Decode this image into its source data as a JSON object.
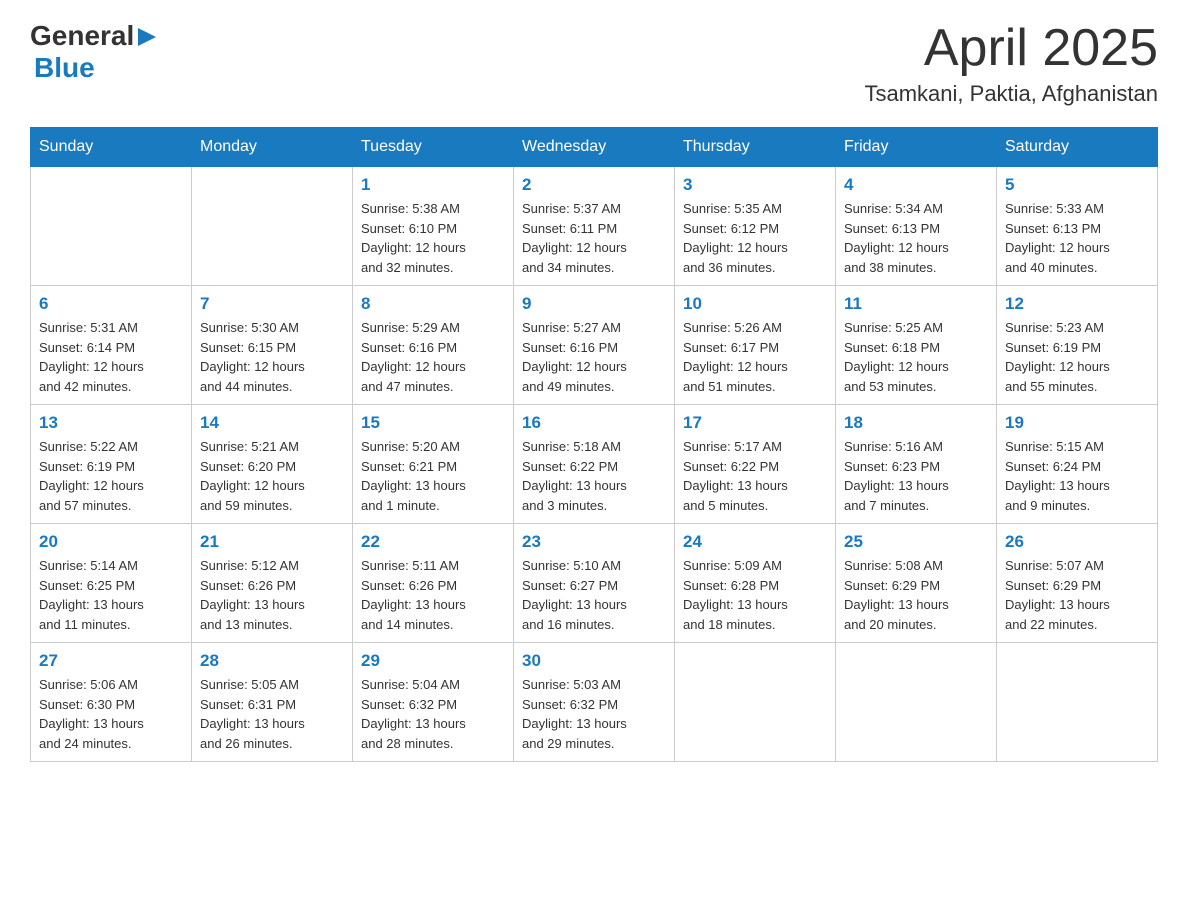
{
  "header": {
    "logo_general": "General",
    "logo_blue": "Blue",
    "title": "April 2025",
    "location": "Tsamkani, Paktia, Afghanistan"
  },
  "calendar": {
    "days_of_week": [
      "Sunday",
      "Monday",
      "Tuesday",
      "Wednesday",
      "Thursday",
      "Friday",
      "Saturday"
    ],
    "weeks": [
      [
        {
          "day": "",
          "info": ""
        },
        {
          "day": "",
          "info": ""
        },
        {
          "day": "1",
          "info": "Sunrise: 5:38 AM\nSunset: 6:10 PM\nDaylight: 12 hours\nand 32 minutes."
        },
        {
          "day": "2",
          "info": "Sunrise: 5:37 AM\nSunset: 6:11 PM\nDaylight: 12 hours\nand 34 minutes."
        },
        {
          "day": "3",
          "info": "Sunrise: 5:35 AM\nSunset: 6:12 PM\nDaylight: 12 hours\nand 36 minutes."
        },
        {
          "day": "4",
          "info": "Sunrise: 5:34 AM\nSunset: 6:13 PM\nDaylight: 12 hours\nand 38 minutes."
        },
        {
          "day": "5",
          "info": "Sunrise: 5:33 AM\nSunset: 6:13 PM\nDaylight: 12 hours\nand 40 minutes."
        }
      ],
      [
        {
          "day": "6",
          "info": "Sunrise: 5:31 AM\nSunset: 6:14 PM\nDaylight: 12 hours\nand 42 minutes."
        },
        {
          "day": "7",
          "info": "Sunrise: 5:30 AM\nSunset: 6:15 PM\nDaylight: 12 hours\nand 44 minutes."
        },
        {
          "day": "8",
          "info": "Sunrise: 5:29 AM\nSunset: 6:16 PM\nDaylight: 12 hours\nand 47 minutes."
        },
        {
          "day": "9",
          "info": "Sunrise: 5:27 AM\nSunset: 6:16 PM\nDaylight: 12 hours\nand 49 minutes."
        },
        {
          "day": "10",
          "info": "Sunrise: 5:26 AM\nSunset: 6:17 PM\nDaylight: 12 hours\nand 51 minutes."
        },
        {
          "day": "11",
          "info": "Sunrise: 5:25 AM\nSunset: 6:18 PM\nDaylight: 12 hours\nand 53 minutes."
        },
        {
          "day": "12",
          "info": "Sunrise: 5:23 AM\nSunset: 6:19 PM\nDaylight: 12 hours\nand 55 minutes."
        }
      ],
      [
        {
          "day": "13",
          "info": "Sunrise: 5:22 AM\nSunset: 6:19 PM\nDaylight: 12 hours\nand 57 minutes."
        },
        {
          "day": "14",
          "info": "Sunrise: 5:21 AM\nSunset: 6:20 PM\nDaylight: 12 hours\nand 59 minutes."
        },
        {
          "day": "15",
          "info": "Sunrise: 5:20 AM\nSunset: 6:21 PM\nDaylight: 13 hours\nand 1 minute."
        },
        {
          "day": "16",
          "info": "Sunrise: 5:18 AM\nSunset: 6:22 PM\nDaylight: 13 hours\nand 3 minutes."
        },
        {
          "day": "17",
          "info": "Sunrise: 5:17 AM\nSunset: 6:22 PM\nDaylight: 13 hours\nand 5 minutes."
        },
        {
          "day": "18",
          "info": "Sunrise: 5:16 AM\nSunset: 6:23 PM\nDaylight: 13 hours\nand 7 minutes."
        },
        {
          "day": "19",
          "info": "Sunrise: 5:15 AM\nSunset: 6:24 PM\nDaylight: 13 hours\nand 9 minutes."
        }
      ],
      [
        {
          "day": "20",
          "info": "Sunrise: 5:14 AM\nSunset: 6:25 PM\nDaylight: 13 hours\nand 11 minutes."
        },
        {
          "day": "21",
          "info": "Sunrise: 5:12 AM\nSunset: 6:26 PM\nDaylight: 13 hours\nand 13 minutes."
        },
        {
          "day": "22",
          "info": "Sunrise: 5:11 AM\nSunset: 6:26 PM\nDaylight: 13 hours\nand 14 minutes."
        },
        {
          "day": "23",
          "info": "Sunrise: 5:10 AM\nSunset: 6:27 PM\nDaylight: 13 hours\nand 16 minutes."
        },
        {
          "day": "24",
          "info": "Sunrise: 5:09 AM\nSunset: 6:28 PM\nDaylight: 13 hours\nand 18 minutes."
        },
        {
          "day": "25",
          "info": "Sunrise: 5:08 AM\nSunset: 6:29 PM\nDaylight: 13 hours\nand 20 minutes."
        },
        {
          "day": "26",
          "info": "Sunrise: 5:07 AM\nSunset: 6:29 PM\nDaylight: 13 hours\nand 22 minutes."
        }
      ],
      [
        {
          "day": "27",
          "info": "Sunrise: 5:06 AM\nSunset: 6:30 PM\nDaylight: 13 hours\nand 24 minutes."
        },
        {
          "day": "28",
          "info": "Sunrise: 5:05 AM\nSunset: 6:31 PM\nDaylight: 13 hours\nand 26 minutes."
        },
        {
          "day": "29",
          "info": "Sunrise: 5:04 AM\nSunset: 6:32 PM\nDaylight: 13 hours\nand 28 minutes."
        },
        {
          "day": "30",
          "info": "Sunrise: 5:03 AM\nSunset: 6:32 PM\nDaylight: 13 hours\nand 29 minutes."
        },
        {
          "day": "",
          "info": ""
        },
        {
          "day": "",
          "info": ""
        },
        {
          "day": "",
          "info": ""
        }
      ]
    ]
  }
}
